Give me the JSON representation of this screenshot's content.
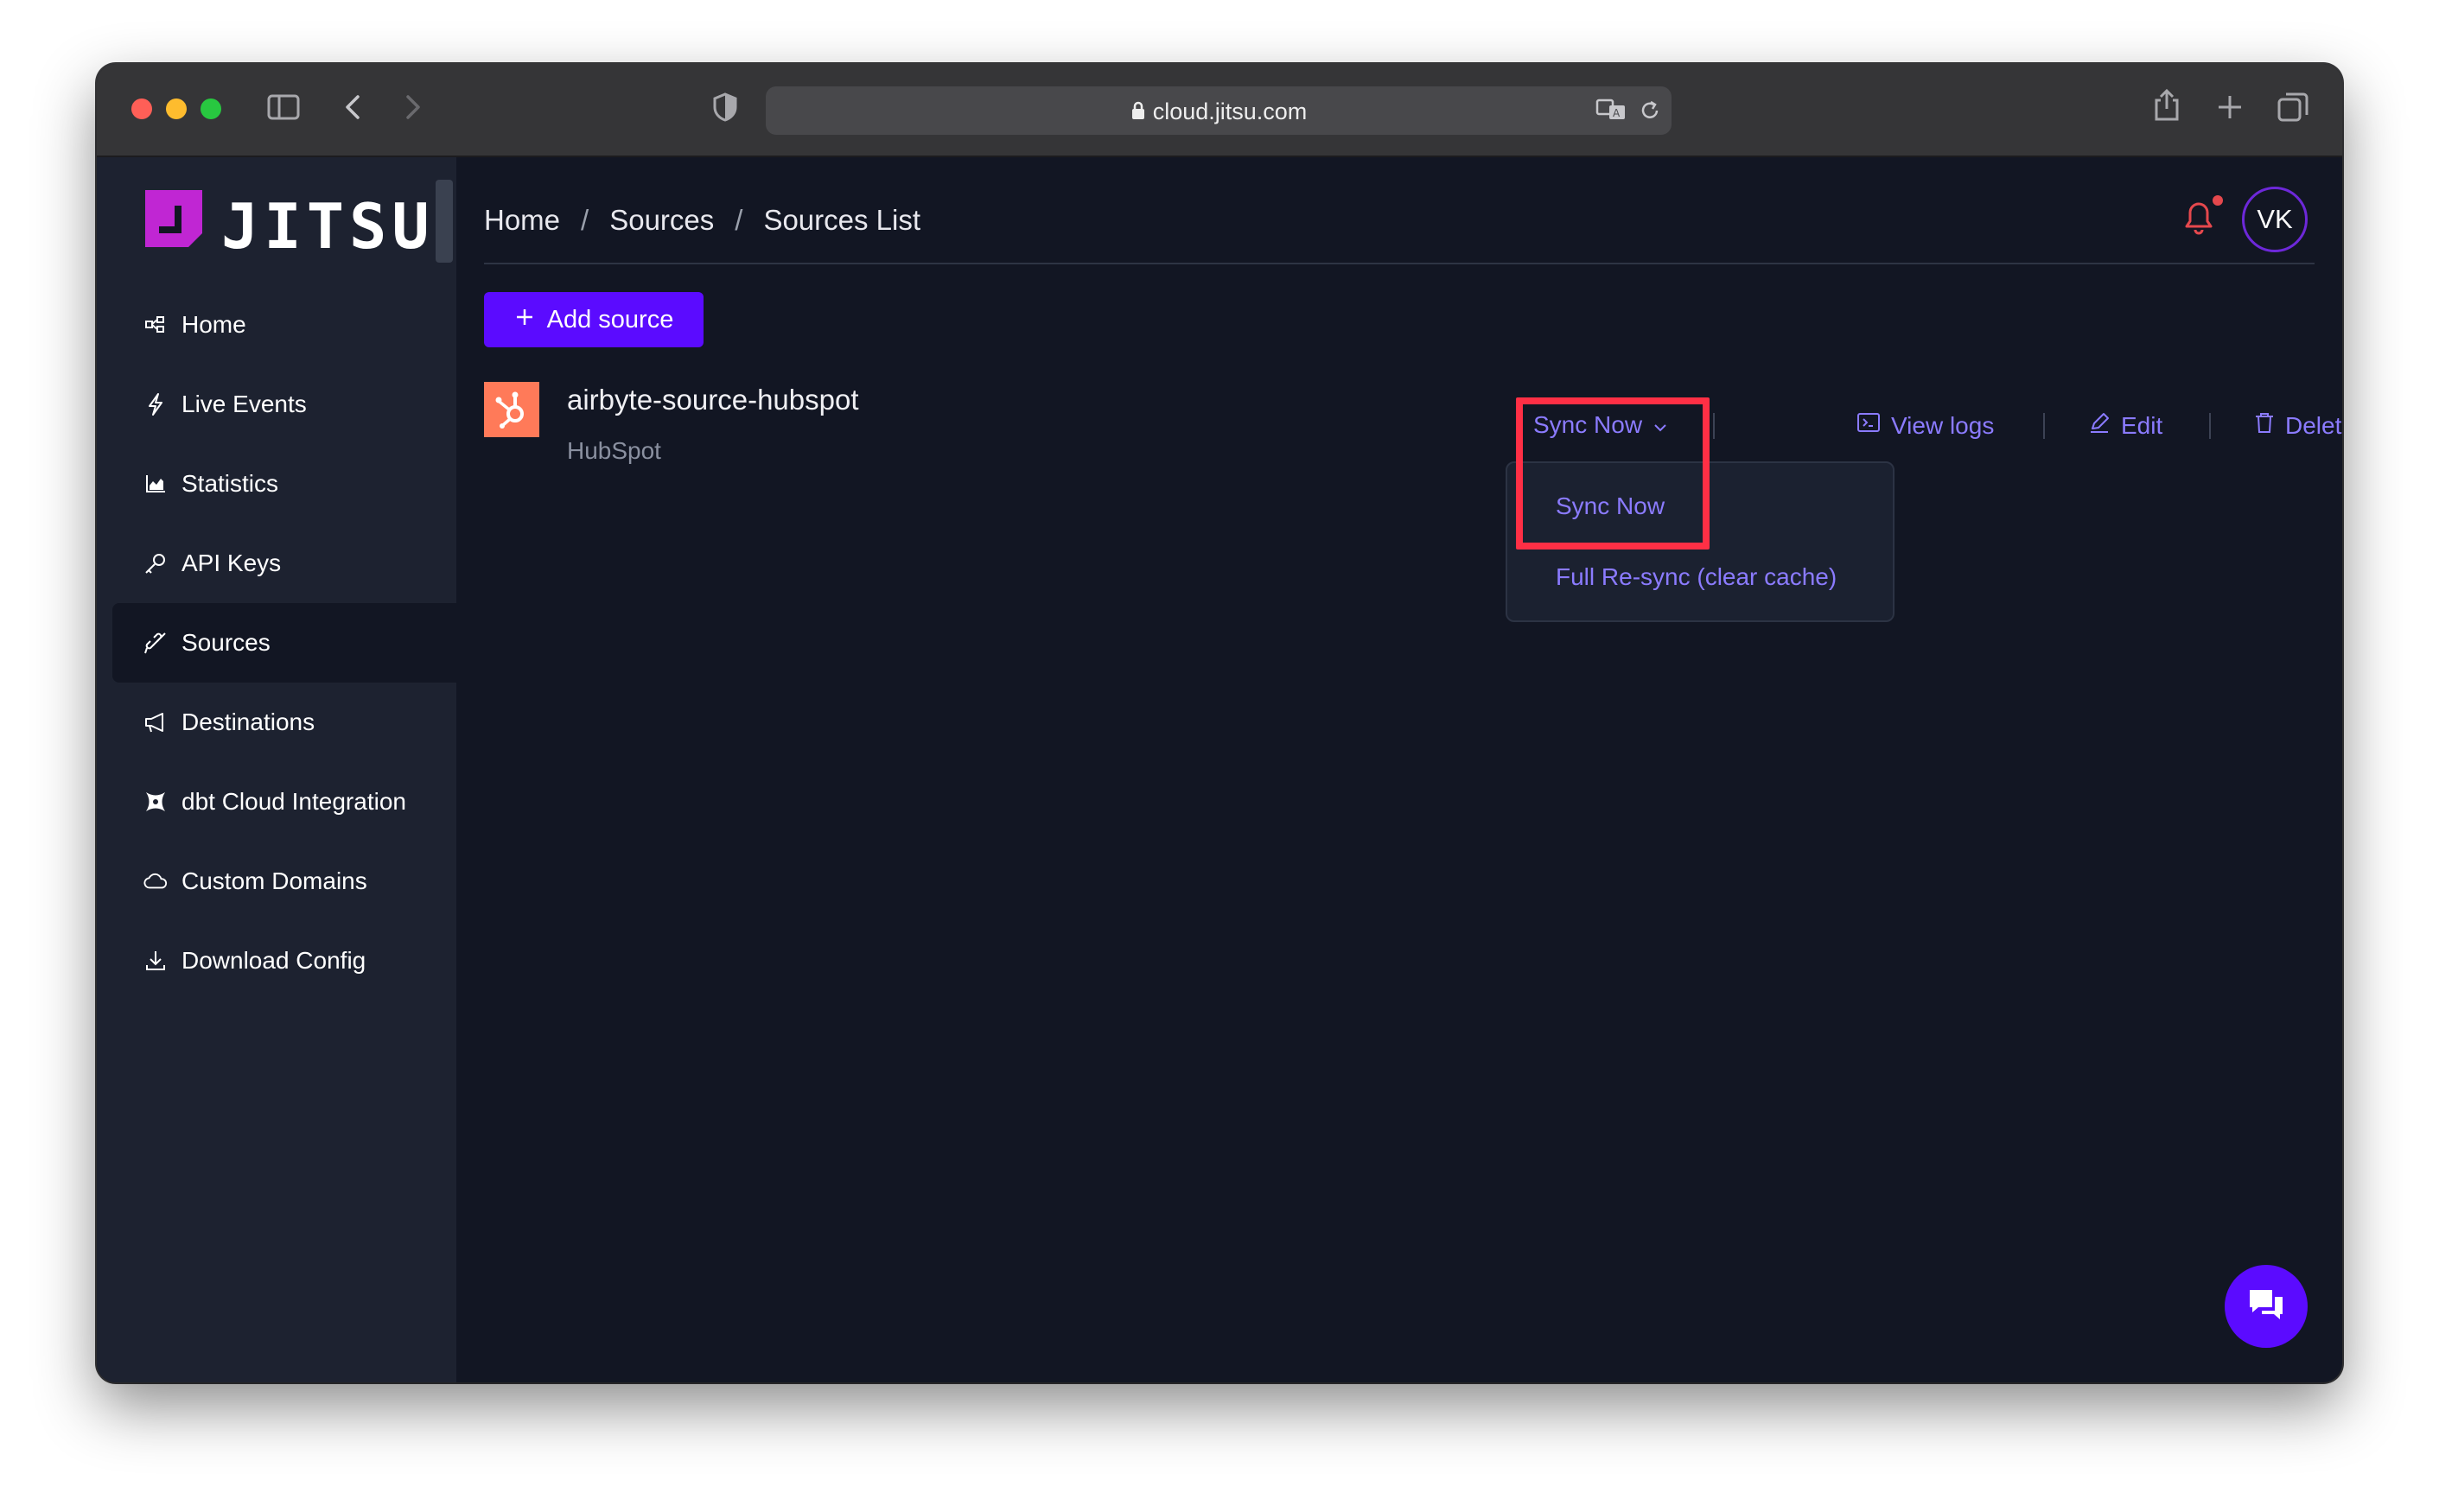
{
  "browser": {
    "url": "cloud.jitsu.com"
  },
  "brand": {
    "name": "JITSU",
    "accent": "#5b0bff",
    "logo_color": "#c026d3"
  },
  "sidebar": {
    "items": [
      {
        "label": "Home",
        "icon": "home-icon"
      },
      {
        "label": "Live Events",
        "icon": "lightning-icon"
      },
      {
        "label": "Statistics",
        "icon": "chart-icon"
      },
      {
        "label": "API Keys",
        "icon": "key-icon"
      },
      {
        "label": "Sources",
        "icon": "plug-icon",
        "active": true
      },
      {
        "label": "Destinations",
        "icon": "megaphone-icon"
      },
      {
        "label": "dbt Cloud Integration",
        "icon": "dbt-icon"
      },
      {
        "label": "Custom Domains",
        "icon": "cloud-icon"
      },
      {
        "label": "Download Config",
        "icon": "download-icon"
      }
    ]
  },
  "header": {
    "breadcrumb": [
      "Home",
      "Sources",
      "Sources List"
    ],
    "separator": "/",
    "avatar_initials": "VK"
  },
  "main": {
    "add_button_label": "Add source",
    "source": {
      "name": "airbyte-source-hubspot",
      "type": "HubSpot",
      "icon": "hubspot-icon"
    },
    "actions": {
      "sync_now": "Sync Now",
      "view_logs": "View logs",
      "edit": "Edit",
      "delete": "Delete"
    },
    "dropdown": {
      "items": [
        "Sync Now",
        "Full Re-sync (clear cache)"
      ]
    }
  }
}
